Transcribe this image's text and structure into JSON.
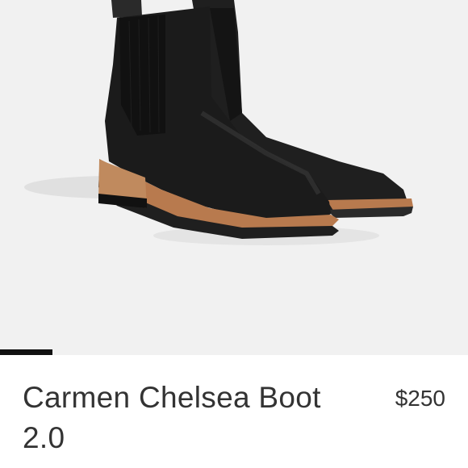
{
  "product": {
    "name": "Carmen Chelsea Boot 2.0",
    "price": "$250",
    "image_alt": "black-leather-chelsea-boots"
  },
  "carousel": {
    "active_index": 1
  },
  "colors": {
    "image_background": "#f1f1f1",
    "text": "#333333",
    "indicator": "#111111",
    "leather": "#1b1b1b",
    "sole": "#b87a4e"
  }
}
